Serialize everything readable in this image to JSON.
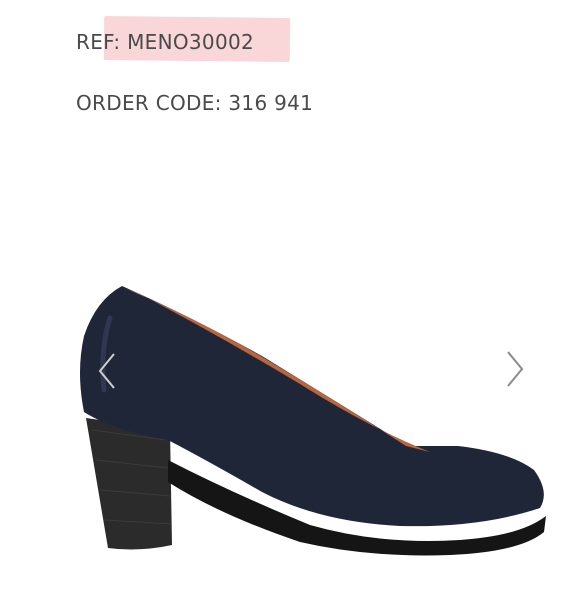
{
  "product": {
    "ref_label": "REF:",
    "ref_value": "MENO30002",
    "order_label": "ORDER CODE:",
    "order_value": "316 941"
  },
  "gallery": {
    "image_name": "navy-leather-block-heel-pump",
    "prev_icon": "chevron-left-icon",
    "next_icon": "chevron-right-icon"
  },
  "colors": {
    "text": "#4a4a4a",
    "highlight": "#f9d6d8",
    "shoe_upper": "#1f2638",
    "shoe_lining": "#b9653d",
    "heel": "#2b2b2b",
    "sole": "#151515"
  }
}
